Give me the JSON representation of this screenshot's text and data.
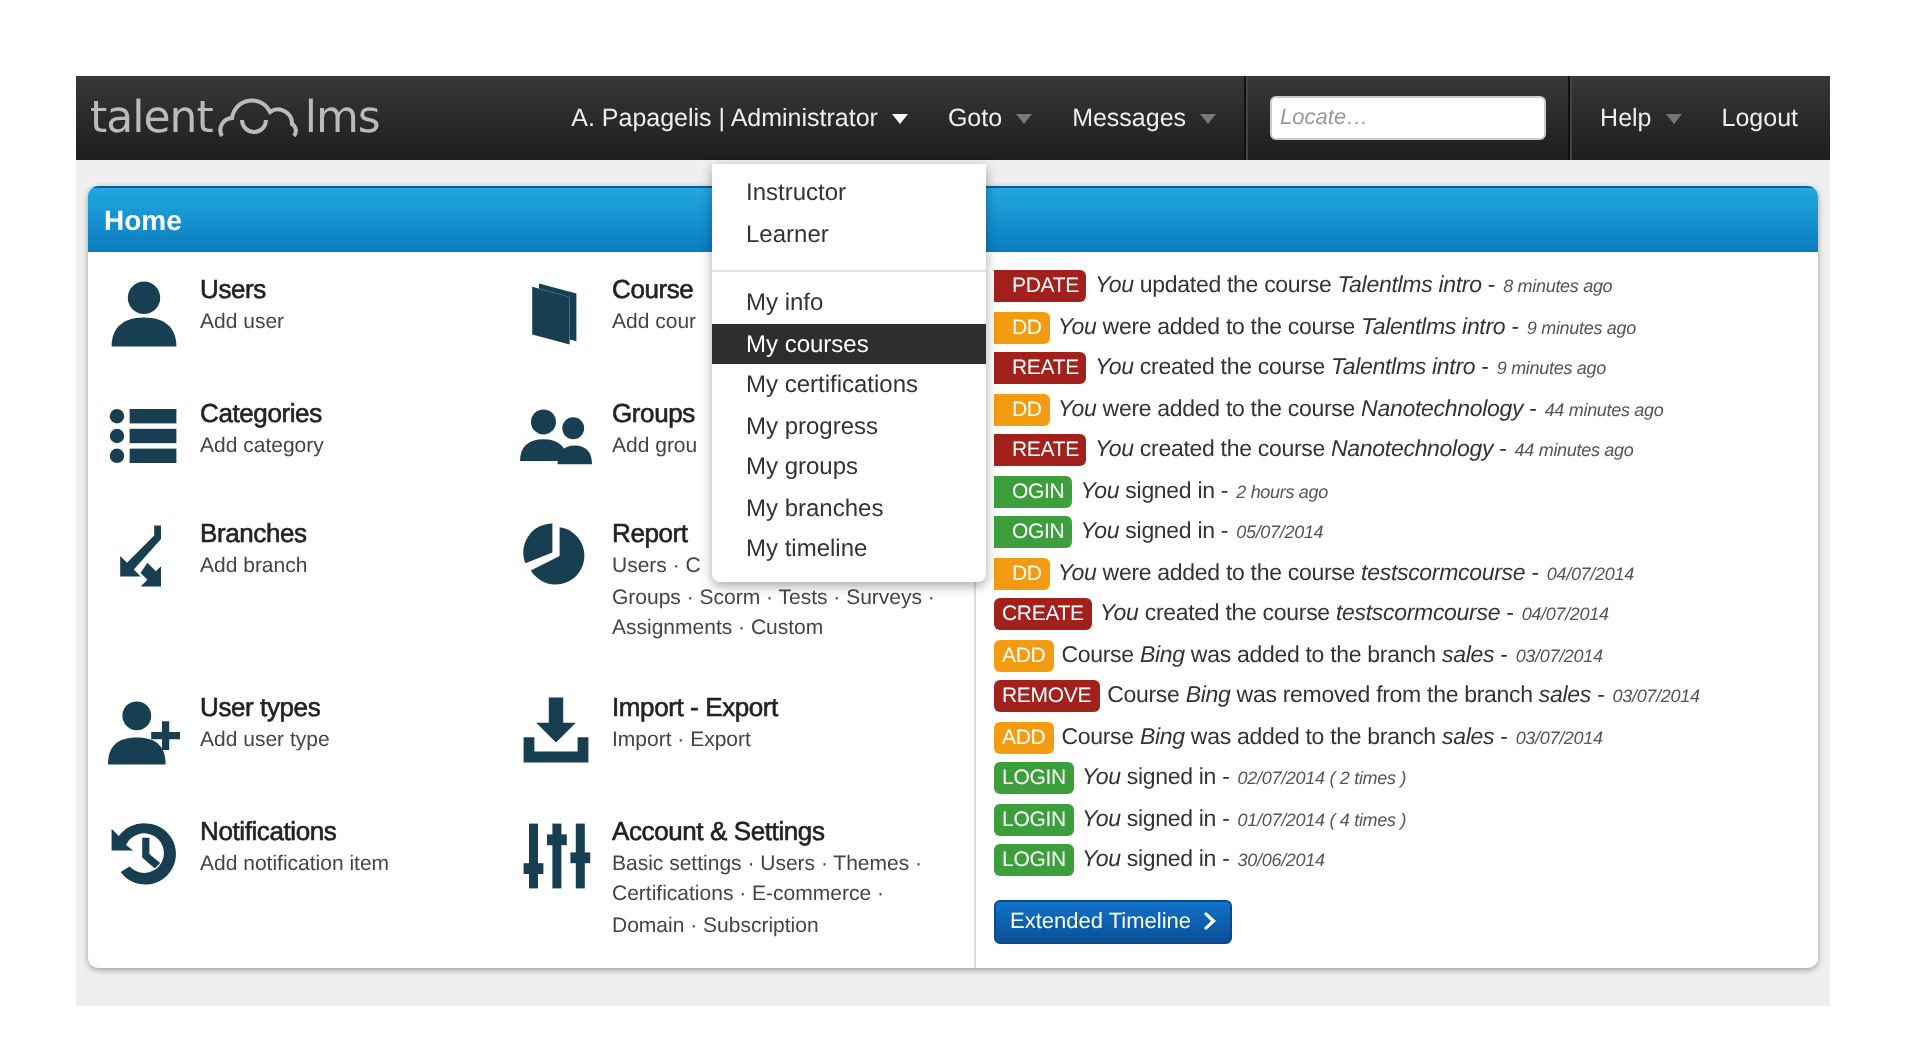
{
  "logo": {
    "left": "talent",
    "right": "lms"
  },
  "nav": [
    {
      "kind": "menu",
      "label": "A. Papagelis | Administrator",
      "expanded": true
    },
    {
      "kind": "menu",
      "label": "Goto",
      "expanded": false
    },
    {
      "kind": "menu",
      "label": "Messages",
      "expanded": false
    },
    {
      "kind": "search",
      "placeholder": "Locate…"
    },
    {
      "kind": "menu",
      "label": "Help",
      "expanded": false
    },
    {
      "kind": "link",
      "label": "Logout"
    }
  ],
  "dropdown": {
    "sections": [
      {
        "items": [
          {
            "label": "Instructor",
            "selected": false
          },
          {
            "label": "Learner",
            "selected": false
          }
        ]
      },
      {
        "items": [
          {
            "label": "My info",
            "selected": false
          },
          {
            "label": "My courses",
            "selected": true
          },
          {
            "label": "My certifications",
            "selected": false
          },
          {
            "label": "My progress",
            "selected": false
          },
          {
            "label": "My groups",
            "selected": false
          },
          {
            "label": "My branches",
            "selected": false
          },
          {
            "label": "My timeline",
            "selected": false
          }
        ]
      }
    ]
  },
  "panel": {
    "title": "Home",
    "modules": [
      {
        "kind": "user",
        "title": "Users",
        "lines": [
          "Add user"
        ]
      },
      {
        "kind": "book",
        "title": "Course",
        "lines": [
          "Add cour"
        ]
      },
      {
        "kind": "list",
        "title": "Categories",
        "lines": [
          "Add category"
        ]
      },
      {
        "kind": "users",
        "title": "Groups",
        "lines": [
          "Add grou"
        ]
      },
      {
        "kind": "branch",
        "title": "Branches",
        "lines": [
          "Add branch"
        ]
      },
      {
        "kind": "pie",
        "title": "Report",
        "lines": [
          "Users · C",
          "Groups · Scorm · Tests · Surveys ·",
          "Assignments · Custom"
        ]
      },
      {
        "kind": "user-plus",
        "title": "User types",
        "lines": [
          "Add user type"
        ]
      },
      {
        "kind": "download",
        "title": "Import - Export",
        "lines": [
          "Import · Export"
        ]
      },
      {
        "kind": "history",
        "title": "Notifications",
        "lines": [
          "Add notification item"
        ]
      },
      {
        "kind": "sliders",
        "title": "Account & Settings",
        "lines": [
          "Basic settings · Users · Themes ·",
          "Certifications · E-commerce ·",
          "Domain · Subscription"
        ]
      }
    ],
    "timeline": [
      {
        "kind": "update",
        "badge": "PDATE",
        "cut": true,
        "text": "*You* updated the course *Talentlms intro* -",
        "time": "8 minutes ago"
      },
      {
        "kind": "add",
        "badge": "DD",
        "cut": true,
        "text": "*You* were added to the course *Talentlms intro* -",
        "time": "9 minutes ago"
      },
      {
        "kind": "create",
        "badge": "REATE",
        "cut": true,
        "text": "*You* created the course *Talentlms intro* -",
        "time": "9 minutes ago"
      },
      {
        "kind": "add",
        "badge": "DD",
        "cut": true,
        "text": "*You* were added to the course *Nanotechnology* -",
        "time": "44 minutes ago"
      },
      {
        "kind": "create",
        "badge": "REATE",
        "cut": true,
        "text": "*You* created the course *Nanotechnology* -",
        "time": "44 minutes ago"
      },
      {
        "kind": "login",
        "badge": "OGIN",
        "cut": true,
        "text": "*You* signed in -",
        "time": "2 hours ago"
      },
      {
        "kind": "login",
        "badge": "OGIN",
        "cut": true,
        "text": "*You* signed in -",
        "time": "05/07/2014"
      },
      {
        "kind": "add",
        "badge": "DD",
        "cut": true,
        "text": "*You* were added to the course *testscormcourse* -",
        "time": "04/07/2014"
      },
      {
        "kind": "create",
        "badge": "CREATE",
        "cut": false,
        "text": "*You* created the course *testscormcourse* -",
        "time": "04/07/2014"
      },
      {
        "kind": "add",
        "badge": "ADD",
        "cut": false,
        "text": "Course *Bing* was added to the branch *sales* -",
        "time": "03/07/2014"
      },
      {
        "kind": "remove",
        "badge": "REMOVE",
        "cut": false,
        "text": "Course *Bing* was removed from the branch *sales* -",
        "time": "03/07/2014"
      },
      {
        "kind": "add",
        "badge": "ADD",
        "cut": false,
        "text": "Course *Bing* was added to the branch *sales* -",
        "time": "03/07/2014"
      },
      {
        "kind": "login",
        "badge": "LOGIN",
        "cut": false,
        "text": "*You* signed in -",
        "time": "02/07/2014 ( 2 times )"
      },
      {
        "kind": "login",
        "badge": "LOGIN",
        "cut": false,
        "text": "*You* signed in -",
        "time": "01/07/2014 ( 4 times )"
      },
      {
        "kind": "login",
        "badge": "LOGIN",
        "cut": false,
        "text": "*You* signed in -",
        "time": "30/06/2014"
      }
    ],
    "timeline_button": "Extended Timeline"
  }
}
